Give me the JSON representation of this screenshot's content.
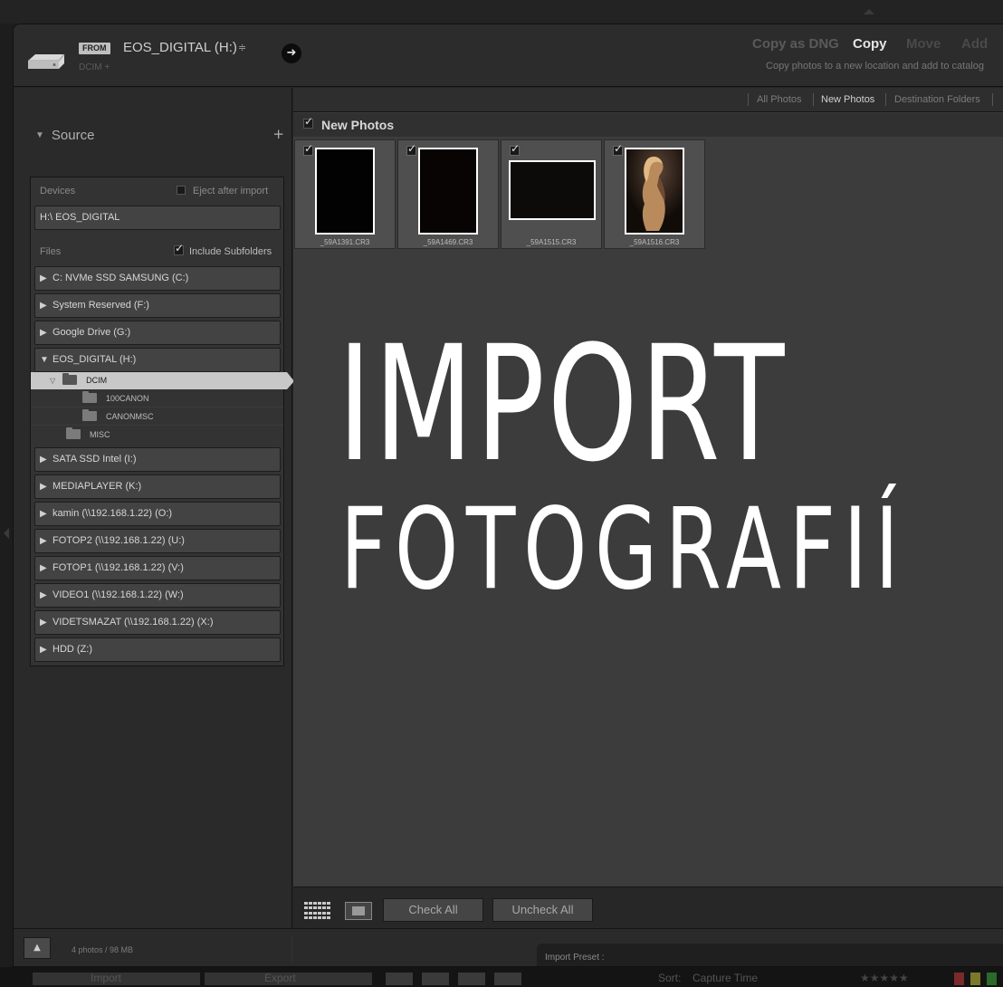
{
  "header": {
    "from_badge": "FROM",
    "source_name": "EOS_DIGITAL (H:)",
    "source_updown": "≑",
    "source_path": "DCIM +",
    "modes": [
      "Copy as DNG",
      "Copy",
      "Move",
      "Add"
    ],
    "active_mode": "Copy",
    "mode_description": "Copy photos to a new location and add to catalog"
  },
  "source_panel": {
    "title": "Source",
    "add_symbol": "+",
    "devices_label": "Devices",
    "eject_label": "Eject after import",
    "device_button": "H:\\ EOS_DIGITAL",
    "files_label": "Files",
    "include_subfolders_label": "Include Subfolders",
    "drives": [
      {
        "label": "C: NVMe SSD SAMSUNG (C:)",
        "expanded": false
      },
      {
        "label": "System Reserved (F:)",
        "expanded": false
      },
      {
        "label": "Google Drive (G:)",
        "expanded": false
      },
      {
        "label": "EOS_DIGITAL (H:)",
        "expanded": true
      },
      {
        "label": "SATA SSD Intel (I:)",
        "expanded": false
      },
      {
        "label": "MEDIAPLAYER (K:)",
        "expanded": false
      },
      {
        "label": "kamin (\\\\192.168.1.22) (O:)",
        "expanded": false
      },
      {
        "label": "FOTOP2 (\\\\192.168.1.22) (U:)",
        "expanded": false
      },
      {
        "label": "FOTOP1 (\\\\192.168.1.22) (V:)",
        "expanded": false
      },
      {
        "label": "VIDEO1 (\\\\192.168.1.22) (W:)",
        "expanded": false
      },
      {
        "label": "VIDETSMAZAT (\\\\192.168.1.22) (X:)",
        "expanded": false
      },
      {
        "label": "HDD (Z:)",
        "expanded": false
      }
    ],
    "folders": [
      {
        "label": "DCIM",
        "selected": true
      },
      {
        "label": "100CANON",
        "selected": false
      },
      {
        "label": "CANONMSC",
        "selected": false
      },
      {
        "label": "MISC",
        "selected": false
      }
    ]
  },
  "view_tabs": [
    "All Photos",
    "New Photos",
    "Destination Folders"
  ],
  "active_tab": "New Photos",
  "grid": {
    "section_title": "New Photos",
    "photos": [
      {
        "filename": "_59A1391.CR3",
        "checked": true
      },
      {
        "filename": "_59A1469.CR3",
        "checked": true
      },
      {
        "filename": "_59A1515.CR3",
        "checked": true
      },
      {
        "filename": "_59A1516.CR3",
        "checked": true
      }
    ]
  },
  "overlay": {
    "line1": "IMPORT",
    "line2": "FOTOGRAFIÍ"
  },
  "toolbar": {
    "check_all": "Check All",
    "uncheck_all": "Uncheck All"
  },
  "status": {
    "count": "4 photos / 98 MB",
    "preset_label": "Import Preset :",
    "collapse_symbol": "▲"
  },
  "background_window": {
    "items": [
      "Import",
      "Export",
      "Sort:",
      "Capture Time"
    ]
  },
  "colors": {
    "panel_bg": "#2a2a2a",
    "grid_bg": "#3c3c3c",
    "active_text": "#e6e6e6",
    "overlay_text": "#ffffff"
  }
}
